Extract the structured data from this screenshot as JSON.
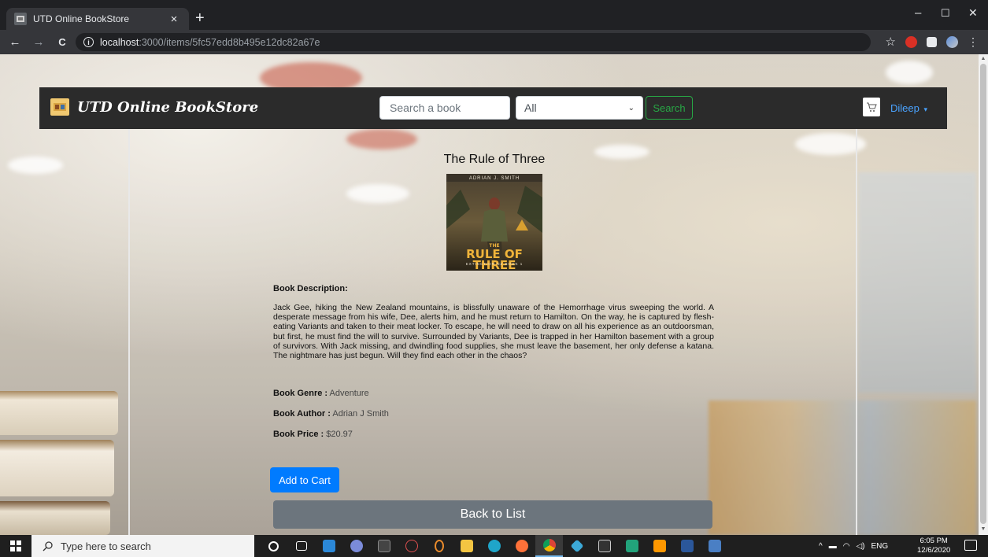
{
  "browser": {
    "tab_title": "UTD Online BookStore",
    "tab_close": "×",
    "new_tab": "+",
    "url_host": "localhost",
    "url_path": ":3000/items/5fc57edd8b495e12dc82a67e",
    "win_minimize": "–",
    "win_maximize": "☐",
    "win_close": "✕",
    "nav_back": "←",
    "nav_forward": "→",
    "nav_reload": "C",
    "info": "i",
    "bookmark_star": "☆"
  },
  "navbar": {
    "brand": "UTD Online BookStore",
    "search_placeholder": "Search a book",
    "genre_selected": "All",
    "search_button": "Search",
    "user_name": "Dileep",
    "user_caret": "▾"
  },
  "book": {
    "title": "The Rule of Three",
    "cover_author": "ADRIAN J. SMITH",
    "cover_title_line1": "RULE OF THREE",
    "cover_title_prefix": "THE",
    "cover_subtitle": "EXTINCTION NZ BOOK 1",
    "description_label": "Book Description:",
    "description": "Jack Gee, hiking the New Zealand mountains, is blissfully unaware of the Hemorrhage virus sweeping the world. A desperate message from his wife, Dee, alerts him, and he must return to Hamilton. On the way, he is captured by flesh-eating Variants and taken to their meat locker. To escape, he will need to draw on all his experience as an outdoorsman, but first, he must find the will to survive. Surrounded by Variants, Dee is trapped in her Hamilton basement with a group of survivors. With Jack missing, and dwindling food supplies, she must leave the basement, her only defense a katana. The nightmare has just begun. Will they find each other in the chaos?",
    "genre_label": "Book Genre :",
    "genre": "Adventure",
    "author_label": "Book Author :",
    "author": "Adrian J Smith",
    "price_label": "Book Price :",
    "price": "$20.97"
  },
  "actions": {
    "add_to_cart": "Add to Cart",
    "back_to_list": "Back to List"
  },
  "taskbar": {
    "search_placeholder": "Type here to search",
    "language": "ENG",
    "time": "6:05 PM",
    "date": "12/6/2020"
  }
}
